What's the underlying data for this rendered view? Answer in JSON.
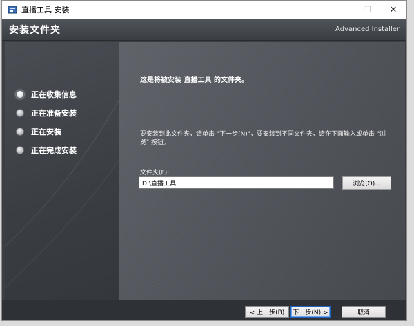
{
  "window": {
    "title": "直播工具 安装",
    "minimize_glyph": "—",
    "maximize_glyph": "☐",
    "close_glyph": "✕"
  },
  "header": {
    "page_title": "安装文件夹",
    "brand": "Advanced Installer"
  },
  "steps": [
    {
      "label": "正在收集信息",
      "active": true
    },
    {
      "label": "正在准备安装",
      "active": false
    },
    {
      "label": "正在安装",
      "active": false
    },
    {
      "label": "正在完成安装",
      "active": false
    }
  ],
  "content": {
    "intro": "这是将被安装 直播工具 的文件夹。",
    "desc": "要安装到此文件夹，请单击 \"下一步(N)\"，要安装到不同文件夹，请在下面输入或单击 \"浏览\" 按钮。",
    "folder_label": "文件夹(F):",
    "folder_value": "D:\\直播工具",
    "browse_label": "浏览(O)..."
  },
  "footer": {
    "back_label": "< 上一步(B)",
    "next_label": "下一步(N) >",
    "cancel_label": "取消"
  },
  "colors": {
    "accent": "#1f64c4",
    "panel_dark": "#3b3f44"
  },
  "icons": {
    "app": "installer-icon"
  }
}
